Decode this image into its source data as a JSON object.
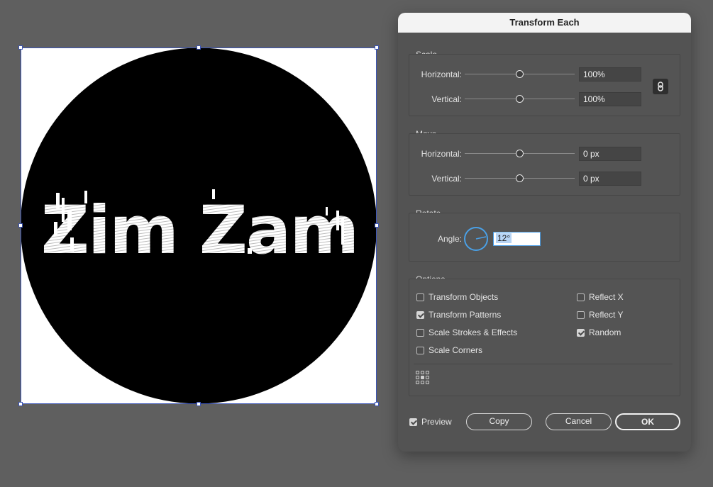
{
  "artwork": {
    "text": "Zim Zam",
    "colors": {
      "circle": "#000000",
      "background": "#ffffff",
      "selection": "#3c55b7"
    }
  },
  "dialog": {
    "title": "Transform Each",
    "scale": {
      "label": "Scale",
      "horizontal_label": "Horizontal:",
      "horizontal_value": "100%",
      "vertical_label": "Vertical:",
      "vertical_value": "100%",
      "link_icon": "link-chain-icon"
    },
    "move": {
      "label": "Move",
      "horizontal_label": "Horizontal:",
      "horizontal_value": "0 px",
      "vertical_label": "Vertical:",
      "vertical_value": "0 px"
    },
    "rotate": {
      "label": "Rotate",
      "angle_label": "Angle:",
      "angle_value": "12°"
    },
    "options": {
      "label": "Options",
      "transform_objects": {
        "label": "Transform Objects",
        "checked": false
      },
      "transform_patterns": {
        "label": "Transform Patterns",
        "checked": true
      },
      "scale_strokes": {
        "label": "Scale Strokes & Effects",
        "checked": false
      },
      "scale_corners": {
        "label": "Scale Corners",
        "checked": false
      },
      "reflect_x": {
        "label": "Reflect X",
        "checked": false
      },
      "reflect_y": {
        "label": "Reflect Y",
        "checked": false
      },
      "random": {
        "label": "Random",
        "checked": true
      }
    },
    "footer": {
      "preview": {
        "label": "Preview",
        "checked": true
      },
      "copy_label": "Copy",
      "cancel_label": "Cancel",
      "ok_label": "OK"
    },
    "accent_color": "#4aa0e6"
  }
}
